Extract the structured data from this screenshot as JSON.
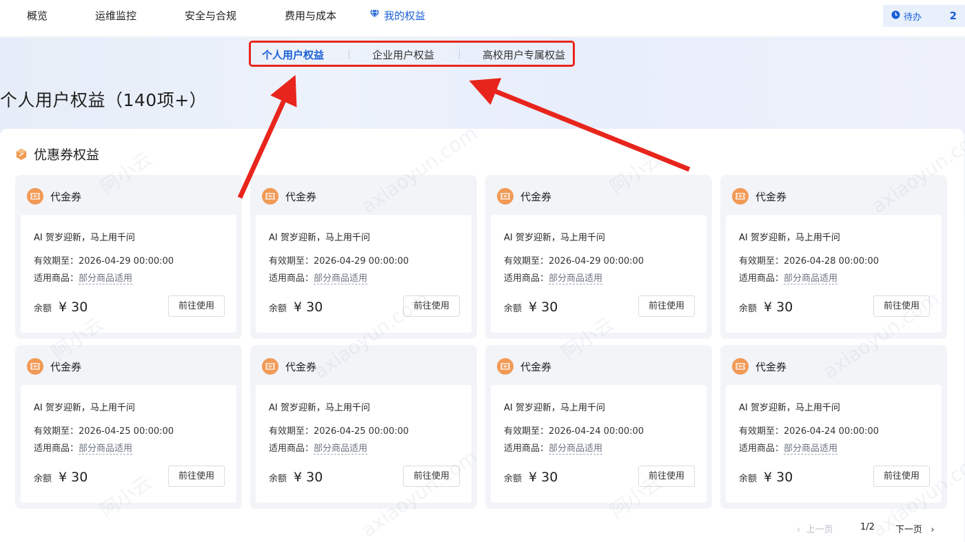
{
  "nav": {
    "items": [
      {
        "label": "概览"
      },
      {
        "label": "运维监控"
      },
      {
        "label": "安全与合规"
      },
      {
        "label": "费用与成本"
      },
      {
        "label": "我的权益"
      }
    ],
    "active_index": 4,
    "todo": {
      "label": "待办",
      "count": "2"
    }
  },
  "subtabs": [
    {
      "label": "个人用户权益"
    },
    {
      "label": "企业用户权益"
    },
    {
      "label": "高校用户专属权益"
    }
  ],
  "page_title": "个人用户权益（140项+）",
  "section": {
    "title": "优惠券权益"
  },
  "cards": [
    {
      "type": "代金券",
      "name": "AI 贺岁迎新，马上用千问",
      "expire": "有效期至：2026-04-29 00:00:00",
      "scope_label": "适用商品：",
      "scope_value": "部分商品适用",
      "balance_label": "余额",
      "amount": "¥ 30",
      "button": "前往使用"
    },
    {
      "type": "代金券",
      "name": "AI 贺岁迎新，马上用千问",
      "expire": "有效期至：2026-04-29 00:00:00",
      "scope_label": "适用商品：",
      "scope_value": "部分商品适用",
      "balance_label": "余额",
      "amount": "¥ 30",
      "button": "前往使用"
    },
    {
      "type": "代金券",
      "name": "AI 贺岁迎新，马上用千问",
      "expire": "有效期至：2026-04-29 00:00:00",
      "scope_label": "适用商品：",
      "scope_value": "部分商品适用",
      "balance_label": "余额",
      "amount": "¥ 30",
      "button": "前往使用"
    },
    {
      "type": "代金券",
      "name": "AI 贺岁迎新，马上用千问",
      "expire": "有效期至：2026-04-28 00:00:00",
      "scope_label": "适用商品：",
      "scope_value": "部分商品适用",
      "balance_label": "余额",
      "amount": "¥ 30",
      "button": "前往使用"
    },
    {
      "type": "代金券",
      "name": "AI 贺岁迎新，马上用千问",
      "expire": "有效期至：2026-04-25 00:00:00",
      "scope_label": "适用商品：",
      "scope_value": "部分商品适用",
      "balance_label": "余额",
      "amount": "¥ 30",
      "button": "前往使用"
    },
    {
      "type": "代金券",
      "name": "AI 贺岁迎新，马上用千问",
      "expire": "有效期至：2026-04-25 00:00:00",
      "scope_label": "适用商品：",
      "scope_value": "部分商品适用",
      "balance_label": "余额",
      "amount": "¥ 30",
      "button": "前往使用"
    },
    {
      "type": "代金券",
      "name": "AI 贺岁迎新，马上用千问",
      "expire": "有效期至：2026-04-24 00:00:00",
      "scope_label": "适用商品：",
      "scope_value": "部分商品适用",
      "balance_label": "余额",
      "amount": "¥ 30",
      "button": "前往使用"
    },
    {
      "type": "代金券",
      "name": "AI 贺岁迎新，马上用千问",
      "expire": "有效期至：2026-04-24 00:00:00",
      "scope_label": "适用商品：",
      "scope_value": "部分商品适用",
      "balance_label": "余额",
      "amount": "¥ 30",
      "button": "前往使用"
    }
  ],
  "pagination": {
    "prev": "上一页",
    "page": "1/2",
    "next": "下一页"
  },
  "watermark": {
    "text": "阿小云",
    "domain": "axiaoyun.com"
  },
  "colors": {
    "accent": "#1a5fd6",
    "highlight": "#e8251c",
    "coupon": "#f19a56"
  },
  "icons": {
    "nav_active": "diamond-icon",
    "todo": "clock-icon",
    "section": "coupon-section-icon",
    "card": "ticket-icon"
  }
}
